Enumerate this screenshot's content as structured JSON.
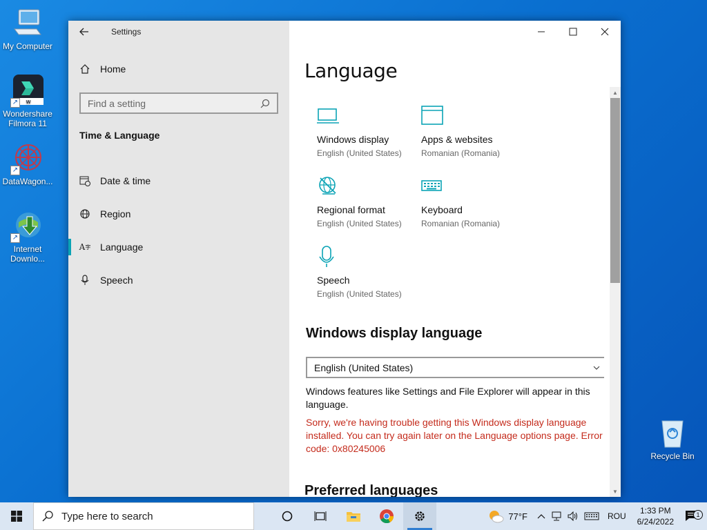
{
  "desktop": {
    "icons": [
      {
        "label": "My Computer"
      },
      {
        "label": "Wondershare Filmora 11"
      },
      {
        "label": "DataWagon..."
      },
      {
        "label": "Internet Downlo..."
      },
      {
        "label": "Recycle Bin"
      }
    ]
  },
  "window": {
    "title": "Settings",
    "sidebar": {
      "home_label": "Home",
      "search_placeholder": "Find a setting",
      "section_title": "Time & Language",
      "nav": [
        {
          "label": "Date & time",
          "icon": "calendar-clock-icon"
        },
        {
          "label": "Region",
          "icon": "globe-icon"
        },
        {
          "label": "Language",
          "icon": "language-icon",
          "active": true
        },
        {
          "label": "Speech",
          "icon": "microphone-icon"
        }
      ]
    },
    "main": {
      "title": "Language",
      "tiles": [
        {
          "name": "Windows display",
          "sub": "English (United States)",
          "icon": "monitor-icon"
        },
        {
          "name": "Apps & websites",
          "sub": "Romanian (Romania)",
          "icon": "browser-window-icon"
        },
        {
          "name": "Regional format",
          "sub": "English (United States)",
          "icon": "regional-format-icon"
        },
        {
          "name": "Keyboard",
          "sub": "Romanian (Romania)",
          "icon": "keyboard-icon"
        },
        {
          "name": "Speech",
          "sub": "English (United States)",
          "icon": "microphone-icon"
        }
      ],
      "display_language_heading": "Windows display language",
      "display_language_value": "English (United States)",
      "display_language_desc": "Windows features like Settings and File Explorer will appear in this language.",
      "error_text": "Sorry, we're having trouble getting this Windows display language installed. You can try again later on the Language options page. Error code: 0x80245006",
      "preferred_heading": "Preferred languages"
    },
    "accent_color": "#0aa3b5",
    "error_color": "#c42b1c"
  },
  "taskbar": {
    "search_placeholder": "Type here to search",
    "weather_temp": "77°F",
    "input_language": "ROU",
    "time": "1:33 PM",
    "date": "6/24/2022",
    "notification_count": "1"
  }
}
